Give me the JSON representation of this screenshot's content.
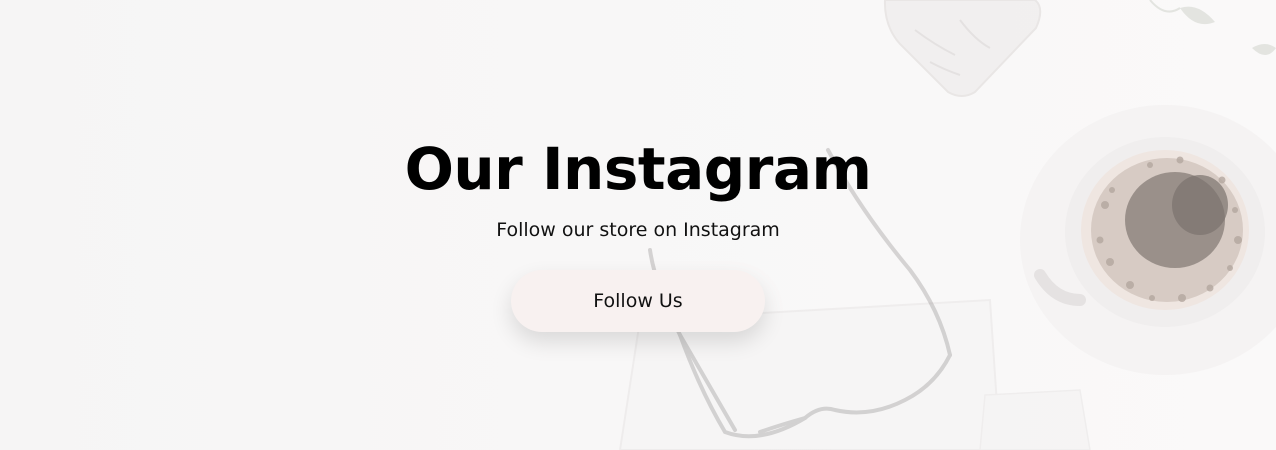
{
  "section": {
    "title": "Our Instagram",
    "subtitle": "Follow our store on Instagram",
    "button_label": "Follow Us"
  },
  "colors": {
    "title": "#000000",
    "text": "#111111",
    "button_bg": "#f8f1f0",
    "background": "#f7f6f6"
  }
}
